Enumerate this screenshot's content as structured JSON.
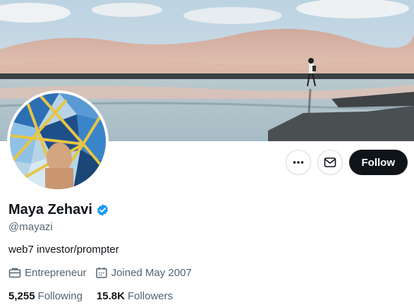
{
  "profile": {
    "display_name": "Maya Zehavi",
    "handle": "@mayazi",
    "bio": "web7 investor/prompter",
    "category": "Entrepreneur",
    "joined": "Joined May 2007",
    "following_count": "5,255",
    "following_label": "Following",
    "followers_count": "15.8K",
    "followers_label": "Followers"
  },
  "actions": {
    "more_icon": "more-icon",
    "message_icon": "envelope-icon",
    "follow_label": "Follow"
  },
  "icons": {
    "verified": "verified-badge-icon",
    "category": "briefcase-icon",
    "joined": "calendar-icon"
  },
  "colors": {
    "verified": "#1d9bf0",
    "follow_bg": "#0f1419",
    "secondary_text": "#536471"
  }
}
